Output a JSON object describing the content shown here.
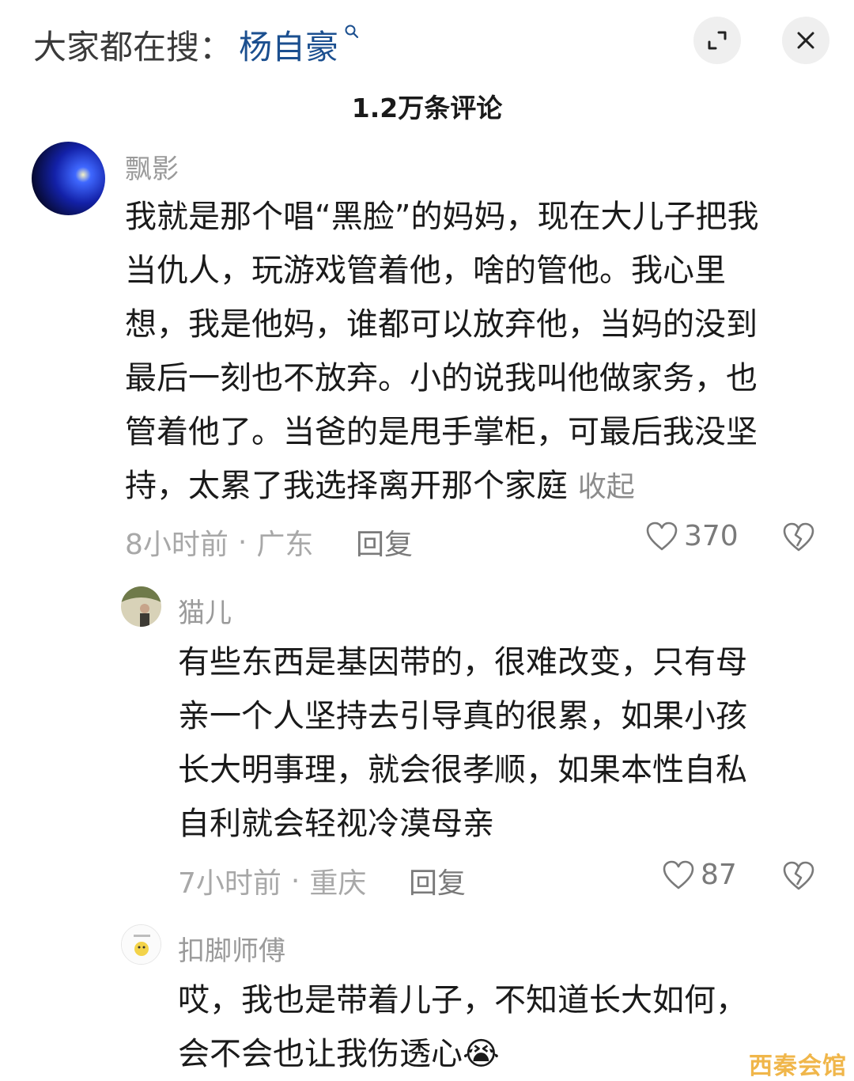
{
  "search": {
    "prefix": "大家都在搜：",
    "term": "杨自豪"
  },
  "header": {
    "comment_count": "1.2万条评论"
  },
  "comments": [
    {
      "username": "飘影",
      "lines": [
        "我就是那个唱“黑脸”的妈妈，现在大儿子把我",
        "当仇人，玩游戏管着他，啥的管他。我心里",
        "想，我是他妈，谁都可以放弃他，当妈的没到",
        "最后一刻也不放弃。小的说我叫他做家务，也",
        "管着他了。当爸的是甩手掌柜，可最后我没坚",
        "持，太累了我选择离开那个家庭"
      ],
      "collapse_label": "收起",
      "time": "8小时前",
      "location": "广东",
      "reply_label": "回复",
      "likes": "370"
    },
    {
      "username": "猫儿",
      "lines": [
        "有些东西是基因带的，很难改变，只有母",
        "亲一个人坚持去引导真的很累，如果小孩",
        "长大明事理，就会很孝顺，如果本性自私",
        "自利就会轻视冷漠母亲"
      ],
      "time": "7小时前",
      "location": "重庆",
      "reply_label": "回复",
      "likes": "87"
    },
    {
      "username": "扣脚师傅",
      "lines": [
        "哎，我也是带着儿子，不知道长大如何，",
        "会不会也让我伤透心"
      ],
      "emoji": "😭"
    }
  ],
  "watermark": "西秦会馆",
  "colors": {
    "search_term": "#1b4f8f",
    "meta_gray": "#a8a8a8",
    "username_gray": "#9a9a9a",
    "button_bg": "#efefef"
  }
}
